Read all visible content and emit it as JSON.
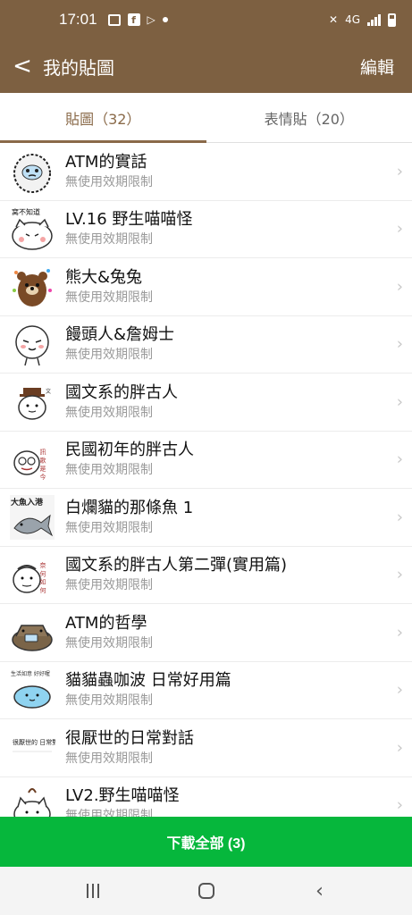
{
  "status_bar": {
    "time": "17:01",
    "network": "4G"
  },
  "header": {
    "back": "<",
    "title": "我的貼圖",
    "edit": "編輯"
  },
  "tabs": [
    {
      "label": "貼圖（32）"
    },
    {
      "label": "表情貼（20）"
    }
  ],
  "stickers": [
    {
      "title": "ATM的實話",
      "subtitle": "無使用效期限制"
    },
    {
      "title": "LV.16 野生喵喵怪",
      "subtitle": "無使用效期限制"
    },
    {
      "title": "熊大&兔兔",
      "subtitle": "無使用效期限制"
    },
    {
      "title": "饅頭人&詹姆士",
      "subtitle": "無使用效期限制"
    },
    {
      "title": "國文系的胖古人",
      "subtitle": "無使用效期限制"
    },
    {
      "title": "民國初年的胖古人",
      "subtitle": "無使用效期限制"
    },
    {
      "title": "白爛貓的那條魚 1",
      "subtitle": "無使用效期限制"
    },
    {
      "title": "國文系的胖古人第二彈(實用篇)",
      "subtitle": "無使用效期限制"
    },
    {
      "title": "ATM的哲學",
      "subtitle": "無使用效期限制"
    },
    {
      "title": "貓貓蟲咖波 日常好用篇",
      "subtitle": "無使用效期限制"
    },
    {
      "title": "很厭世的日常對話",
      "subtitle": "無使用效期限制"
    },
    {
      "title": "LV2.野生喵喵怪",
      "subtitle": "無使用效期限制"
    }
  ],
  "thumb_text": {
    "lv16": "窝不知道",
    "fish": "大魚入港",
    "minguo": "訊 歌 是 今",
    "guwen2": "奈 何 如 何",
    "capoo": "生活如意 好好喔",
    "yanshi": "很厭世的 日常對話"
  },
  "download": {
    "label": "下載全部 (3)"
  },
  "colors": {
    "brand_brown": "#7d6041",
    "download_green": "#06b73c"
  }
}
